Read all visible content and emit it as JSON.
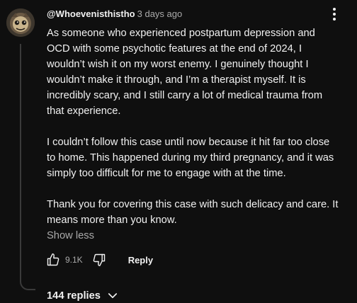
{
  "comment": {
    "author": "@Whoevenisthistho",
    "timestamp": "3 days ago",
    "avatar_icon": "avatar-illustration-icon",
    "lines": [
      "As someone who experienced postpartum depression and",
      "OCD with some psychotic features at the end of 2024, I",
      "wouldn’t wish it on my worst enemy. I genuinely thought I",
      "wouldn’t make it through, and I’m a therapist myself. It is",
      "incredibly scary, and I still carry a lot of medical trauma from",
      "that experience.",
      "",
      "I couldn’t follow this case until now because it hit far too close",
      "to home. This happened during my third pregnancy, and it was",
      "simply too difficult for me to engage with at the time.",
      "",
      "Thank you for covering this case with such delicacy and care. It",
      "means more than you know."
    ],
    "show_less_label": "Show less",
    "like_count": "9.1K",
    "like_icon": "thumbs-up-icon",
    "dislike_icon": "thumbs-down-icon",
    "reply_label": "Reply",
    "menu_icon": "more-vertical-icon",
    "replies_label": "144 replies",
    "replies_icon": "chevron-down-icon"
  },
  "colors": {
    "background": "#0f0f0f",
    "primary_text": "#f1f1f1",
    "secondary_text": "#aaaaaa",
    "thread_line": "#3a3a3a"
  }
}
